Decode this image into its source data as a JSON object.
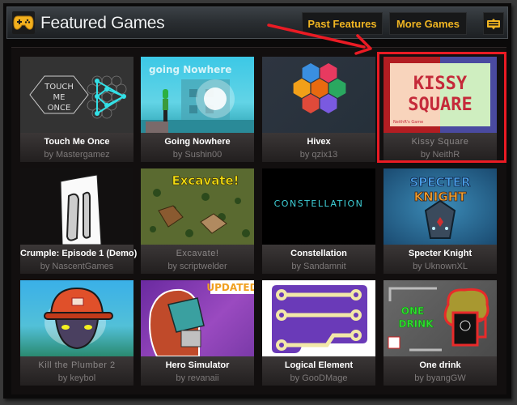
{
  "header": {
    "title": "Featured Games",
    "logo_icon": "gamepad-icon",
    "buttons": {
      "past_features": "Past Features",
      "more_games": "More Games",
      "menu_icon": "menu-icon"
    }
  },
  "colors": {
    "accent": "#f0b522",
    "highlight": "#ea1b24",
    "title_text": "#f2f4f6",
    "author_text": "#7d7979"
  },
  "thumb_text": {
    "touch_me_once": [
      "TOUCH",
      "ME",
      "ONCE"
    ],
    "going_nowhere": "going Nowhere",
    "kissy_line1": "KISSY",
    "kissy_line2": "SQUARE",
    "kissy_credit": "NeithR's Game",
    "excavate": "Excavate!",
    "constellation": "CONSTELLATION",
    "specter_line1": "SPECTER",
    "specter_line2": "KNIGHT",
    "updated_badge": "UPDATED",
    "one_drink_line1": "ONE",
    "one_drink_line2": "DRINK"
  },
  "games": [
    {
      "title": "Touch Me Once",
      "author": "by Mastergamez",
      "visited": false
    },
    {
      "title": "Going Nowhere",
      "author": "by Sushin00",
      "visited": false
    },
    {
      "title": "Hivex",
      "author": "by qzix13",
      "visited": false
    },
    {
      "title": "Kissy Square",
      "author": "by NeithR",
      "visited": true,
      "highlighted": true
    },
    {
      "title": "Crumple: Episode 1 (Demo)",
      "author": "by NascentGames",
      "visited": false
    },
    {
      "title": "Excavate!",
      "author": "by scriptwelder",
      "visited": true
    },
    {
      "title": "Constellation",
      "author": "by Sandamnit",
      "visited": false
    },
    {
      "title": "Specter Knight",
      "author": "by UknownXL",
      "visited": false
    },
    {
      "title": "Kill the Plumber 2",
      "author": "by keybol",
      "visited": true
    },
    {
      "title": "Hero Simulator",
      "author": "by revanaii",
      "visited": false,
      "badge": "UPDATED"
    },
    {
      "title": "Logical Element",
      "author": "by GooDMage",
      "visited": false
    },
    {
      "title": "One drink",
      "author": "by byangGW",
      "visited": false
    }
  ],
  "annotation": {
    "arrow_color": "#ea1b24",
    "points_to": "Kissy Square"
  }
}
